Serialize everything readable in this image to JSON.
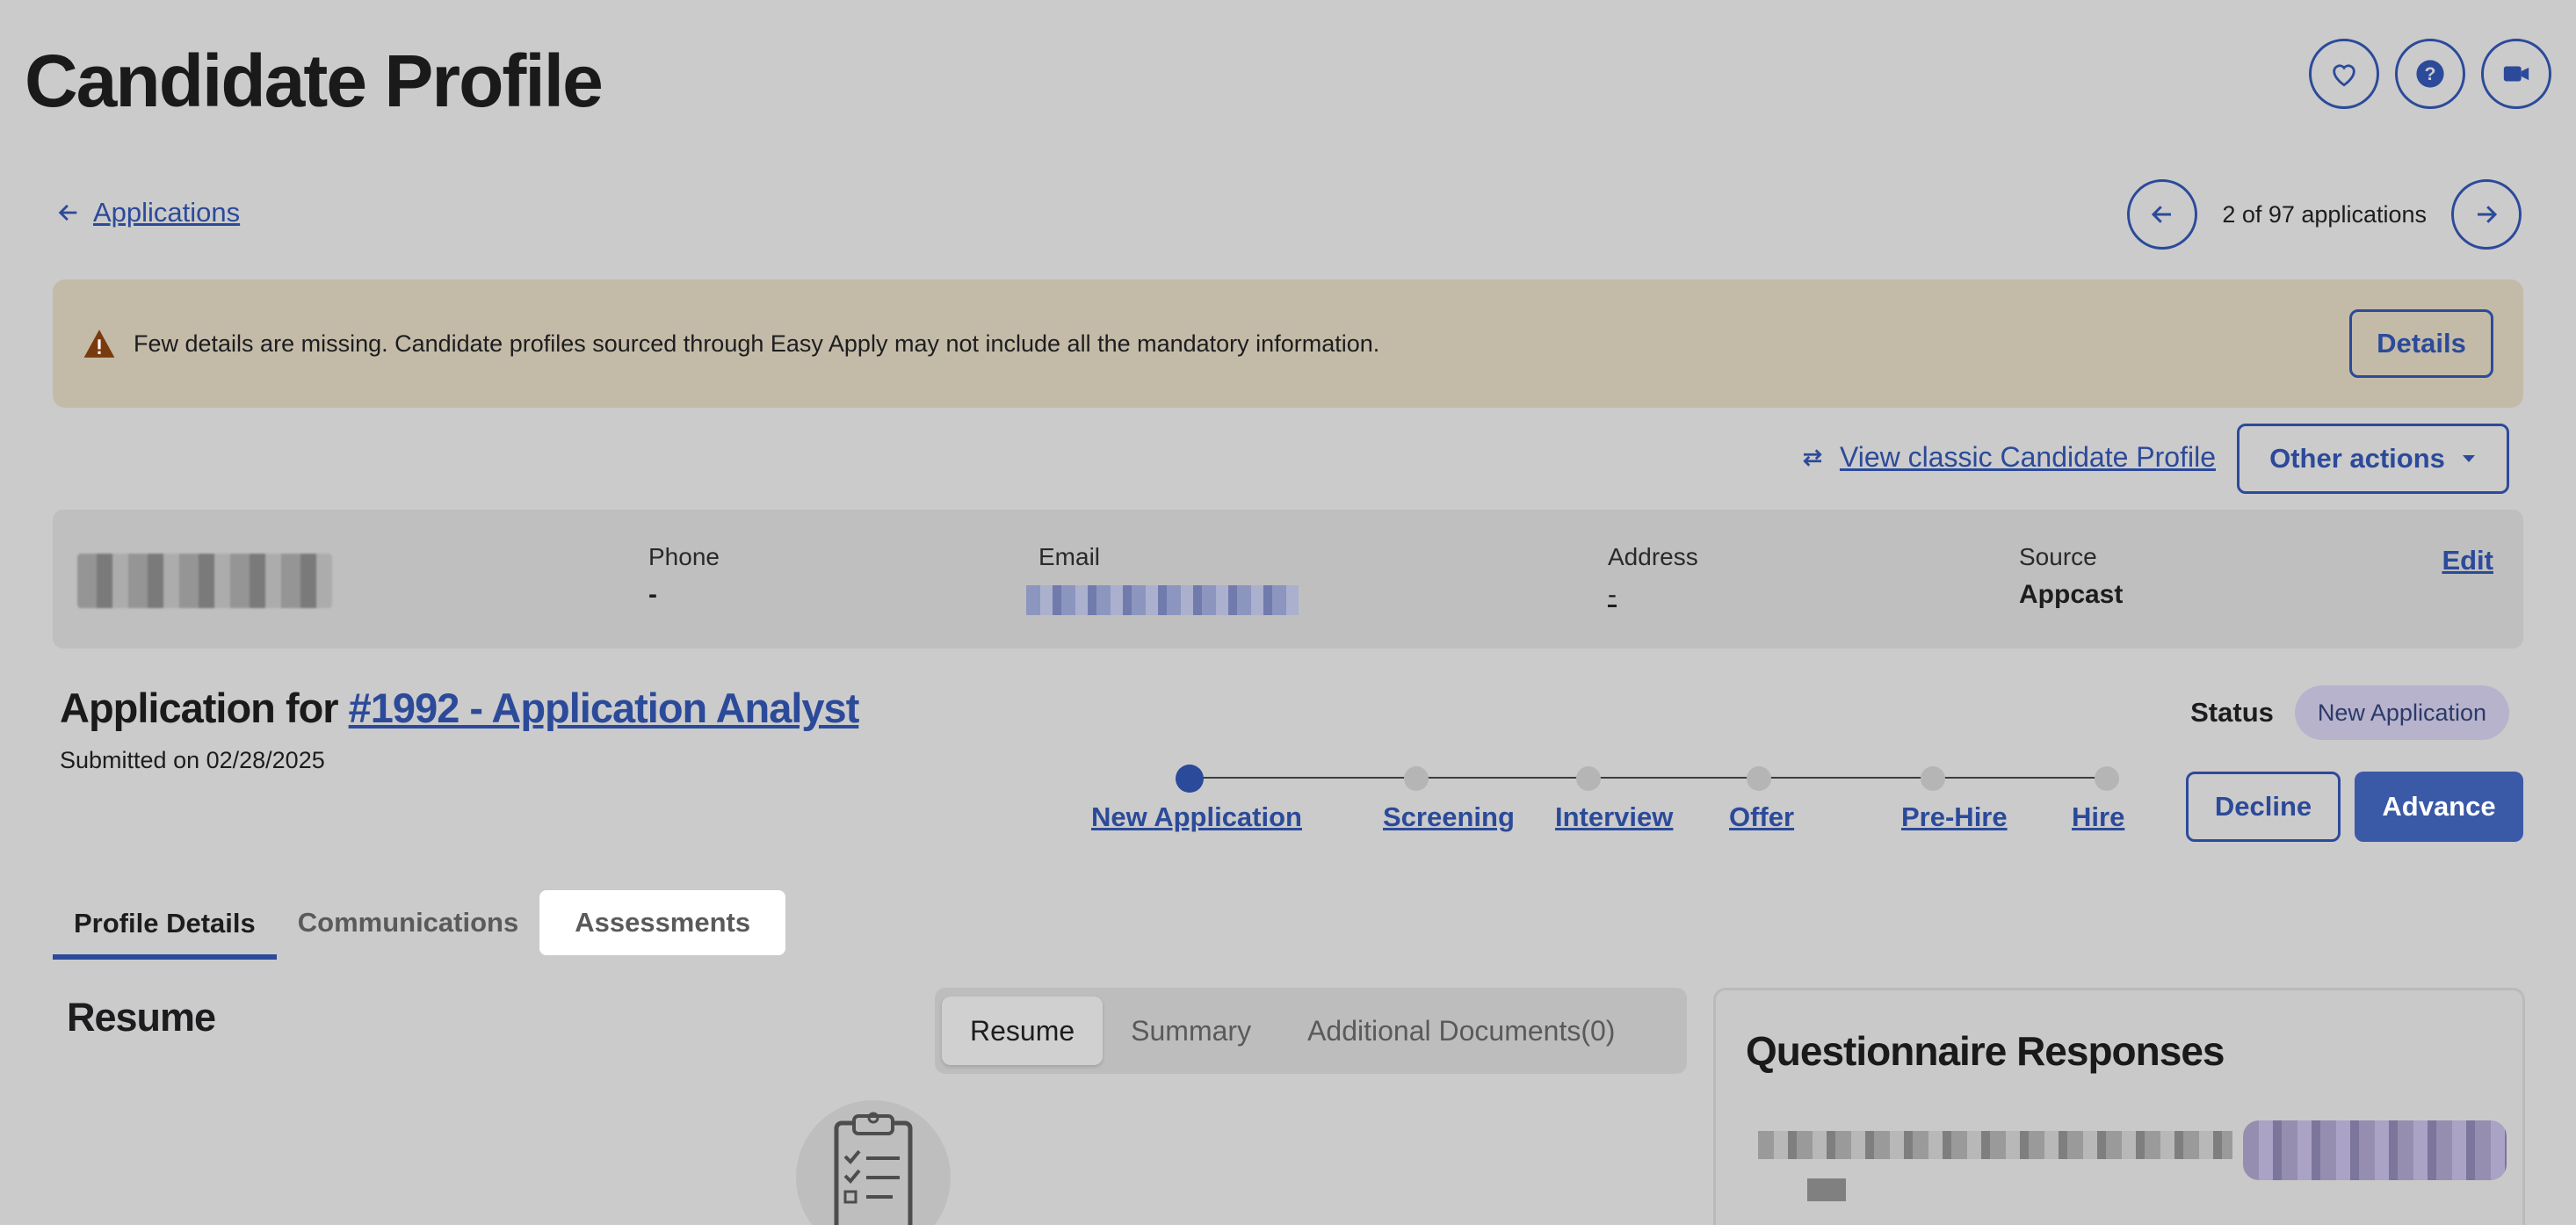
{
  "page": {
    "title": "Candidate Profile"
  },
  "header_icons": [
    "heart-icon",
    "help-icon",
    "video-camera-icon"
  ],
  "breadcrumb": {
    "back_label": "Applications"
  },
  "pager": {
    "text": "2 of 97 applications"
  },
  "alert": {
    "message": "Few details are missing. Candidate profiles sourced through Easy Apply may not include all the mandatory information.",
    "button": "Details",
    "icon": "warning-icon"
  },
  "actions": {
    "classic_link": "View classic Candidate Profile",
    "other_actions": "Other actions"
  },
  "contact": {
    "phone_label": "Phone",
    "phone_value": "-",
    "email_label": "Email",
    "address_label": "Address",
    "address_value": "-",
    "source_label": "Source",
    "source_value": "Appcast",
    "edit": "Edit"
  },
  "application": {
    "prefix": "Application for ",
    "job_link": "#1992 - Application Analyst",
    "submitted": "Submitted on 02/28/2025",
    "status_label": "Status",
    "status_value": "New Application"
  },
  "stages": [
    "New Application",
    "Screening",
    "Interview",
    "Offer",
    "Pre-Hire",
    "Hire"
  ],
  "stage_current": "New Application",
  "buttons": {
    "decline": "Decline",
    "advance": "Advance"
  },
  "tabs": [
    "Profile Details",
    "Communications",
    "Assessments"
  ],
  "resume": {
    "heading": "Resume",
    "segments": [
      "Resume",
      "Summary",
      "Additional Documents(0)"
    ]
  },
  "questionnaire": {
    "title": "Questionnaire Responses"
  },
  "colors": {
    "accent": "#2c4a9a",
    "alert_bg": "#c3bba8",
    "status_pill": "#b7b3cc"
  }
}
